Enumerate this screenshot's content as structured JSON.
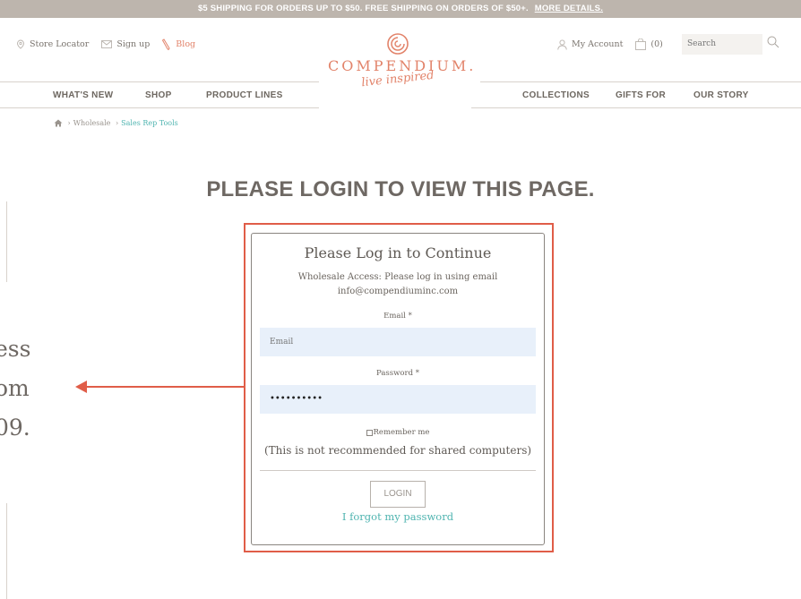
{
  "banner": {
    "text": "$5 SHIPPING FOR ORDERS UP TO $50. FREE SHIPPING ON ORDERS OF $50+.",
    "link": "MORE DETAILS."
  },
  "utility_left": {
    "store_locator": "Store Locator",
    "sign_up": "Sign up",
    "blog": "Blog"
  },
  "utility_right": {
    "account": "My Account",
    "cart_count": "(0)",
    "search_placeholder": "Search"
  },
  "logo": {
    "brand": "COMPENDIUM.",
    "tagline": "live inspired"
  },
  "nav": {
    "whats_new": "WHAT'S NEW",
    "shop": "SHOP",
    "product_lines": "PRODUCT LINES",
    "collections": "COLLECTIONS",
    "gifts_for": "GIFTS FOR",
    "our_story": "OUR STORY"
  },
  "breadcrumb": {
    "wholesale": "Wholesale",
    "current": "Sales Rep Tools"
  },
  "page_heading": "PLEASE LOGIN TO VIEW THIS PAGE.",
  "overlay": {
    "line1": "ess",
    "line2": "om",
    "line3": "09."
  },
  "login": {
    "title": "Please Log in to Continue",
    "desc_line1": "Wholesale Access: Please log in using email",
    "desc_line2": "info@compendiuminc.com",
    "email_label": "Email *",
    "email_placeholder": "Email",
    "password_label": "Password *",
    "password_value": "••••••••••",
    "remember": "Remember me",
    "note": "(This is not recommended for shared computers)",
    "button": "LOGIN",
    "forgot": "I forgot my password"
  },
  "colors": {
    "accent": "#e2836a",
    "teal": "#4fb4b0",
    "highlight": "#e05d48",
    "banner": "#bdb5ad"
  }
}
